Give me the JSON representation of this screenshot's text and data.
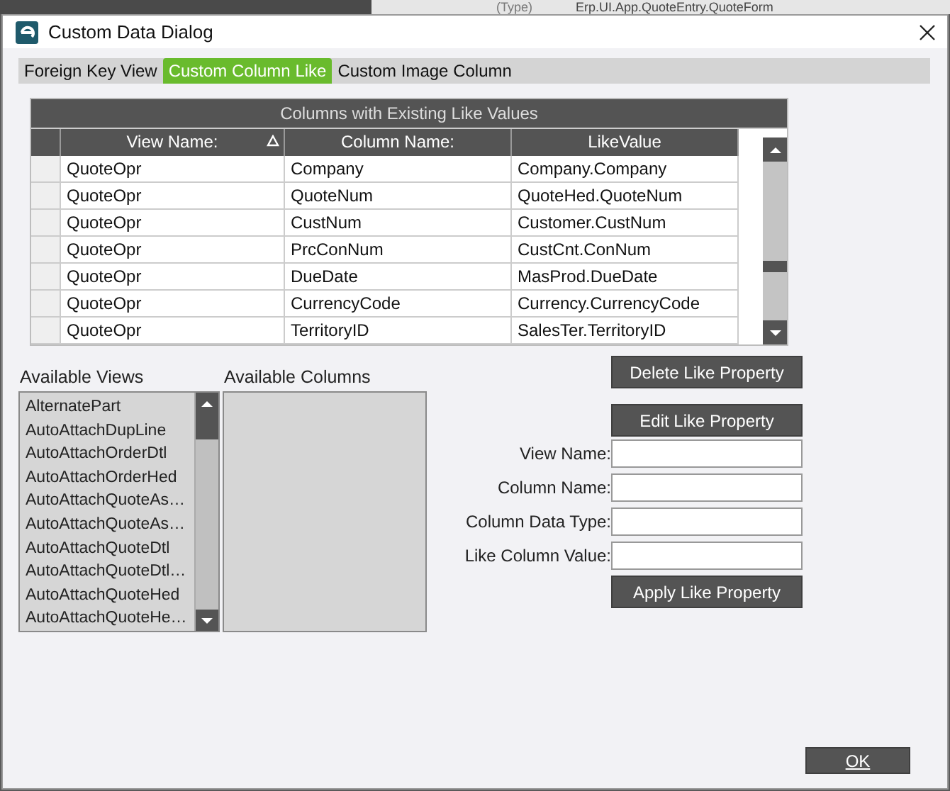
{
  "background": {
    "texts": [
      "(Type)",
      "Erp.UI.App.QuoteEntry.QuoteForm"
    ]
  },
  "window": {
    "title": "Custom Data Dialog"
  },
  "tabs": [
    {
      "label": "Foreign Key View",
      "selected": false
    },
    {
      "label": "Custom Column Like",
      "selected": true
    },
    {
      "label": "Custom Image Column",
      "selected": false
    }
  ],
  "grid": {
    "caption": "Columns with Existing Like Values",
    "columns": [
      "View Name:",
      "Column Name:",
      "LikeValue"
    ],
    "rows": [
      [
        "QuoteOpr",
        "Company",
        "Company.Company"
      ],
      [
        "QuoteOpr",
        "QuoteNum",
        "QuoteHed.QuoteNum"
      ],
      [
        "QuoteOpr",
        "CustNum",
        "Customer.CustNum"
      ],
      [
        "QuoteOpr",
        "PrcConNum",
        "CustCnt.ConNum"
      ],
      [
        "QuoteOpr",
        "DueDate",
        "MasProd.DueDate"
      ],
      [
        "QuoteOpr",
        "CurrencyCode",
        "Currency.CurrencyCode"
      ],
      [
        "QuoteOpr",
        "TerritoryID",
        "SalesTer.TerritoryID"
      ]
    ]
  },
  "available_views": {
    "label": "Available Views",
    "items": [
      "AlternatePart",
      "AutoAttachDupLine",
      "AutoAttachOrderDtl",
      "AutoAttachOrderHed",
      "AutoAttachQuoteAs…",
      "AutoAttachQuoteAs…",
      "AutoAttachQuoteDtl",
      "AutoAttachQuoteDtl…",
      "AutoAttachQuoteHed",
      "AutoAttachQuoteHe…"
    ]
  },
  "available_columns": {
    "label": "Available Columns"
  },
  "buttons": {
    "delete": "Delete Like Property",
    "edit": "Edit Like Property",
    "apply": "Apply Like Property",
    "ok": "OK"
  },
  "fields": [
    {
      "label": "View Name:"
    },
    {
      "label": "Column Name:"
    },
    {
      "label": "Column Data Type:"
    },
    {
      "label": "Like Column Value:"
    }
  ]
}
